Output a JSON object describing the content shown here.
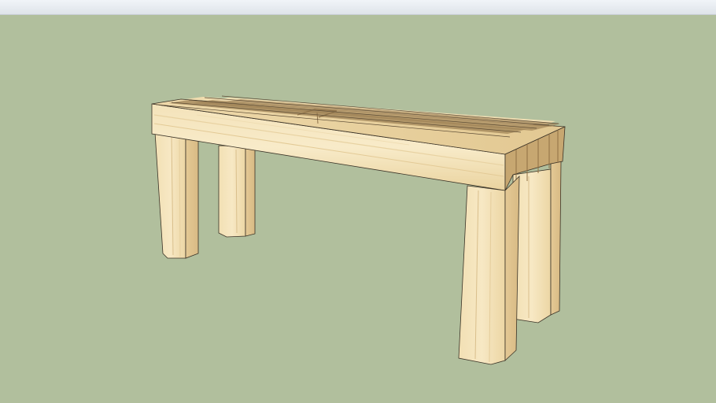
{
  "scene": {
    "subject": "wooden-bench-3d-model",
    "colors": {
      "background": "#b1bf9d",
      "wood_light": "#f3e2b8",
      "wood_mid": "#e9d09c",
      "wood_shadow": "#d9bd86",
      "end_grain": "#b4925f",
      "edge": "#3a3226"
    }
  }
}
